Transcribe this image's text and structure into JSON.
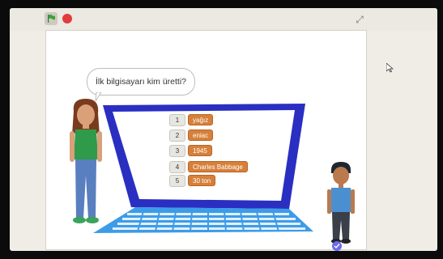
{
  "toolbar": {
    "green_flag_icon": "green-flag-icon",
    "stop_icon": "stop-sign-icon",
    "fullscreen_icon": "fullscreen-toggle-icon",
    "fullscreen_glyph": "⤢"
  },
  "stage": {
    "question": "İlk bilgisayarı kim üretti?",
    "answers": [
      {
        "index": "1",
        "value": "yağız"
      },
      {
        "index": "2",
        "value": "eniac"
      },
      {
        "index": "3",
        "value": "1945"
      },
      {
        "index": "4",
        "value": "Charles Babbage"
      },
      {
        "index": "5",
        "value": "30 ton"
      }
    ]
  },
  "colors": {
    "laptop_frame": "#2a2fc2",
    "keyboard": "#3c9ce8",
    "list_item": "#d6803a",
    "stop": "#e23b3b",
    "flag": "#3aa13a"
  }
}
